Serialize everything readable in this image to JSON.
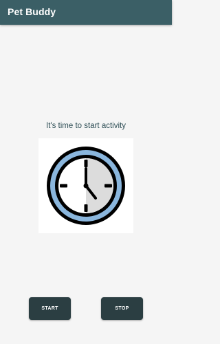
{
  "app_bar": {
    "title": "Pet Buddy",
    "color": "#3b5f66"
  },
  "main": {
    "message": "It's time to start activity",
    "image_icon": "wall-clock-icon"
  },
  "buttons": {
    "start_label": "START",
    "stop_label": "STOP",
    "color": "#2b3e42"
  },
  "colors": {
    "background": "#f5f5f5",
    "clock_ring": "#8ab6dd",
    "clock_outline": "#000000",
    "clock_shade": "#dcdcdc"
  }
}
